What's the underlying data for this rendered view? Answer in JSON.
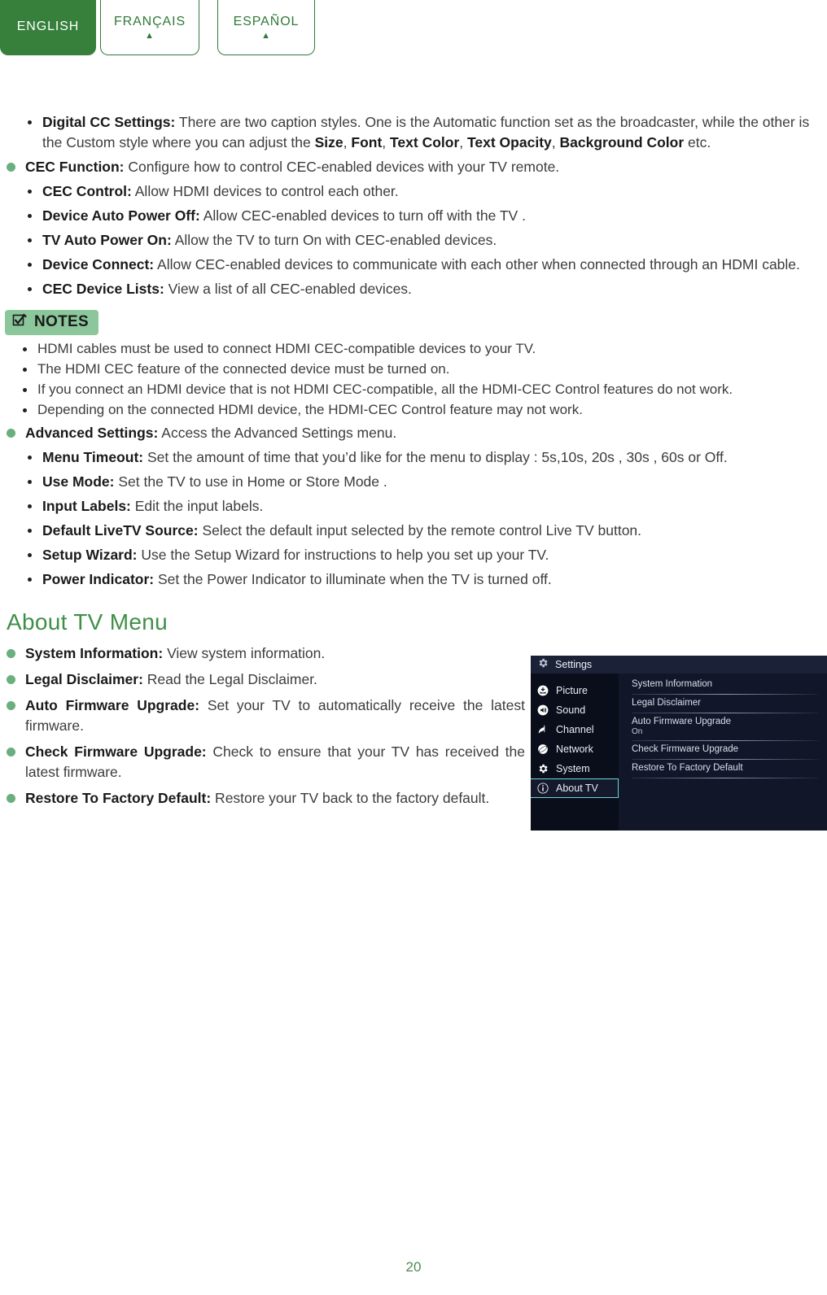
{
  "language_tabs": [
    {
      "label": "ENGLISH",
      "active": true,
      "caret": ""
    },
    {
      "label": "FRANÇAIS",
      "active": false,
      "caret": "▲"
    },
    {
      "label": "ESPAÑOL",
      "active": false,
      "caret": "▲"
    }
  ],
  "settings_section": {
    "items": [
      {
        "level": 2,
        "term": "Digital CC Settings:",
        "text": " There are two caption styles. One is the Automatic function set as the broadcaster, while the other is the Custom style where you can adjust the ",
        "inline_bold": [
          "Size",
          "Font",
          "Text Color",
          "Text Opacity",
          "Background Color"
        ],
        "tail": " etc."
      },
      {
        "level": 1,
        "term": "CEC Function:",
        "text": " Configure how to control CEC-enabled devices with your TV remote."
      },
      {
        "level": 2,
        "term": "CEC Control:",
        "text": " Allow HDMI devices to control each other."
      },
      {
        "level": 2,
        "term": "Device Auto Power Off:",
        "text": " Allow CEC-enabled devices to turn off with the TV ."
      },
      {
        "level": 2,
        "term": "TV Auto Power On:",
        "text": " Allow the TV to turn On with CEC-enabled devices."
      },
      {
        "level": 2,
        "term": "Device Connect:",
        "text": " Allow CEC-enabled devices to communicate with each other when connected through an HDMI cable."
      },
      {
        "level": 2,
        "term": "CEC Device Lists:",
        "text": " View a list of all CEC-enabled devices."
      }
    ]
  },
  "notes": {
    "badge_label": "NOTES",
    "badge_icon": "checkbox-pencil-icon",
    "items": [
      "HDMI cables must be used to connect HDMI CEC-compatible devices to your TV.",
      "The HDMI CEC feature of the connected device must be turned on.",
      "If you connect an HDMI device that is not HDMI CEC-compatible, all the HDMI-CEC Control features do not work.",
      "Depending on the connected HDMI device, the HDMI-CEC Control feature may not work."
    ]
  },
  "advanced_section": {
    "items": [
      {
        "level": 1,
        "term": "Advanced Settings:",
        "text": " Access the Advanced Settings menu."
      },
      {
        "level": 2,
        "term": "Menu Timeout:",
        "text": " Set the amount of time that you’d like for the menu to display : 5s,10s, 20s , 30s , 60s or Off."
      },
      {
        "level": 2,
        "term": "Use Mode:",
        "text": " Set the TV to use in Home or Store Mode ."
      },
      {
        "level": 2,
        "term": "Input Labels:",
        "text": " Edit the input labels."
      },
      {
        "level": 2,
        "term": "Default LiveTV Source:",
        "text": " Select the default input selected by the remote control Live TV button."
      },
      {
        "level": 2,
        "term": "Setup Wizard:",
        "text": " Use the Setup Wizard for instructions to help you set up your TV."
      },
      {
        "level": 2,
        "term": "Power Indicator:",
        "text": " Set the Power Indicator to illuminate when the TV is turned off."
      }
    ]
  },
  "about_section": {
    "heading": "About TV Menu",
    "items": [
      {
        "term": "System Information:",
        "text": " View system information."
      },
      {
        "term": "Legal Disclaimer:",
        "text": " Read the Legal Disclaimer."
      },
      {
        "term": "Auto Firmware Upgrade:",
        "text": " Set your TV to automatically receive the latest firmware."
      },
      {
        "term": "Check Firmware Upgrade:",
        "text": " Check to ensure that your TV has received the latest firmware."
      },
      {
        "term": "Restore To Factory Default:",
        "text": " Restore your TV back to the factory default."
      }
    ]
  },
  "tv_menu": {
    "title": "Settings",
    "title_icon": "gear-icon",
    "sidebar": [
      {
        "label": "Picture",
        "icon": "picture-icon",
        "selected": false
      },
      {
        "label": "Sound",
        "icon": "speaker-icon",
        "selected": false
      },
      {
        "label": "Channel",
        "icon": "satellite-dish-icon",
        "selected": false
      },
      {
        "label": "Network",
        "icon": "globe-icon",
        "selected": false
      },
      {
        "label": "System",
        "icon": "gear-icon",
        "selected": false
      },
      {
        "label": "About TV",
        "icon": "info-icon",
        "selected": true
      }
    ],
    "rows": [
      {
        "label": "System Information",
        "value": ""
      },
      {
        "label": "Legal Disclaimer",
        "value": ""
      },
      {
        "label": "Auto Firmware Upgrade",
        "value": "On"
      },
      {
        "label": "Check Firmware Upgrade",
        "value": ""
      },
      {
        "label": "Restore To Factory Default",
        "value": ""
      }
    ]
  },
  "page_number": "20",
  "colors": {
    "brand_green": "#37803c",
    "heading_green": "#3f8f48",
    "bullet_green": "#6aaf7e",
    "notes_badge_bg": "#8cc79b",
    "tv_bg": "#111729",
    "tv_titlebar": "#1b2238",
    "tv_select_cyan": "#6fd3d8"
  }
}
